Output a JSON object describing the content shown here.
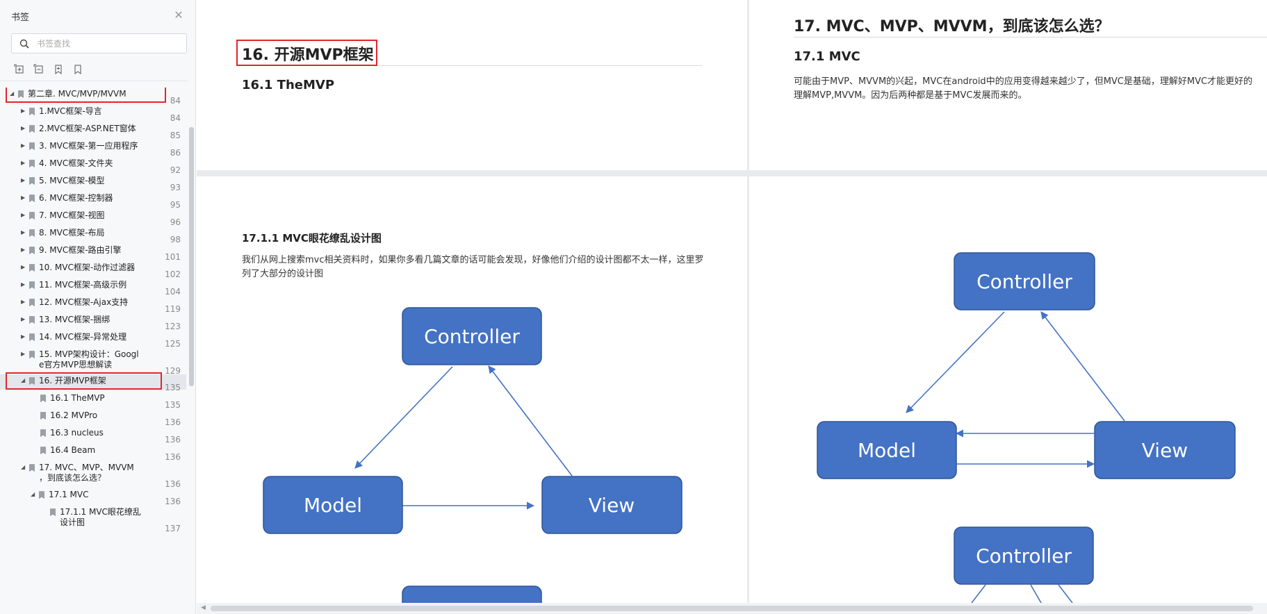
{
  "sidebar": {
    "title": "书签",
    "search_placeholder": "书签查找",
    "tools": [
      "expand-all-icon",
      "collapse-all-icon",
      "add-bookmark-icon",
      "bookmark-icon"
    ],
    "items": [
      {
        "label": "第二章. MVC/MVP/MVVM",
        "page": "84",
        "level": 0,
        "expander": "open",
        "highlight": true
      },
      {
        "label": "1.MVC框架-导言",
        "page": "84",
        "level": 1,
        "expander": "closed"
      },
      {
        "label": "2.MVC框架-ASP.NET窗体",
        "page": "85",
        "level": 1,
        "expander": "closed"
      },
      {
        "label": "3. MVC框架-第一应用程序",
        "page": "86",
        "level": 1,
        "expander": "closed"
      },
      {
        "label": "4. MVC框架-文件夹",
        "page": "92",
        "level": 1,
        "expander": "closed"
      },
      {
        "label": "5. MVC框架-模型",
        "page": "93",
        "level": 1,
        "expander": "closed"
      },
      {
        "label": "6. MVC框架-控制器",
        "page": "95",
        "level": 1,
        "expander": "closed"
      },
      {
        "label": "7. MVC框架-视图",
        "page": "96",
        "level": 1,
        "expander": "closed"
      },
      {
        "label": "8. MVC框架-布局",
        "page": "98",
        "level": 1,
        "expander": "closed"
      },
      {
        "label": "9. MVC框架-路由引擎",
        "page": "101",
        "level": 1,
        "expander": "closed"
      },
      {
        "label": "10. MVC框架-动作过滤器",
        "page": "102",
        "level": 1,
        "expander": "closed"
      },
      {
        "label": "11. MVC框架-高级示例",
        "page": "104",
        "level": 1,
        "expander": "closed"
      },
      {
        "label": "12. MVC框架-Ajax支持",
        "page": "119",
        "level": 1,
        "expander": "closed"
      },
      {
        "label": "13. MVC框架-捆绑",
        "page": "123",
        "level": 1,
        "expander": "closed"
      },
      {
        "label": "14. MVC框架-异常处理",
        "page": "125",
        "level": 1,
        "expander": "closed"
      },
      {
        "label": "15. MVP架构设计：Googl\ne官方MVP思想解读",
        "page": "129",
        "level": 1,
        "expander": "closed"
      },
      {
        "label": "16. 开源MVP框架",
        "page": "135",
        "level": 1,
        "expander": "open",
        "highlight": true,
        "selected": true
      },
      {
        "label": "16.1 TheMVP",
        "page": "135",
        "level": 2,
        "expander": "none"
      },
      {
        "label": "16.2  MVPro",
        "page": "136",
        "level": 2,
        "expander": "none"
      },
      {
        "label": "16.3 nucleus",
        "page": "136",
        "level": 2,
        "expander": "none"
      },
      {
        "label": "16.4 Beam",
        "page": "136",
        "level": 2,
        "expander": "none"
      },
      {
        "label": "17. MVC、MVP、MVVM\n，到底该怎么选？",
        "page": "136",
        "level": 1,
        "expander": "open"
      },
      {
        "label": "17.1 MVC",
        "page": "136",
        "level": 2,
        "expander": "open"
      },
      {
        "label": "17.1.1 MVC眼花缭乱\n设计图",
        "page": "137",
        "level": 3,
        "expander": "none"
      }
    ]
  },
  "pages": {
    "top_left": {
      "title": "16. 开源MVP框架",
      "subtitle": "16.1 TheMVP"
    },
    "top_right": {
      "title": "17. MVC、MVP、MVVM，到底该怎么选？",
      "subtitle": "17.1 MVC",
      "paragraph": "可能由于MVP、MVVM的兴起，MVC在android中的应用变得越来越少了，但MVC是基础，理解好MVC才能更好的理解MVP,MVVM。因为后两种都是基于MVC发展而来的。"
    },
    "bottom_left": {
      "heading": "17.1.1 MVC眼花缭乱设计图",
      "paragraph": "我们从网上搜索mvc相关资料时，如果你多看几篇文章的话可能会发现，好像他们介绍的设计图都不太一样，这里罗列了大部分的设计图",
      "diagram": {
        "controller": "Controller",
        "model": "Model",
        "view": "View"
      }
    },
    "bottom_right": {
      "diagram1": {
        "controller": "Controller",
        "model": "Model",
        "view": "View"
      },
      "diagram2": {
        "controller": "Controller"
      }
    }
  },
  "colors": {
    "box_fill": "#4472c4",
    "box_stroke": "#2f5597",
    "arrow": "#4472c4",
    "highlight_red": "#e0262b"
  }
}
